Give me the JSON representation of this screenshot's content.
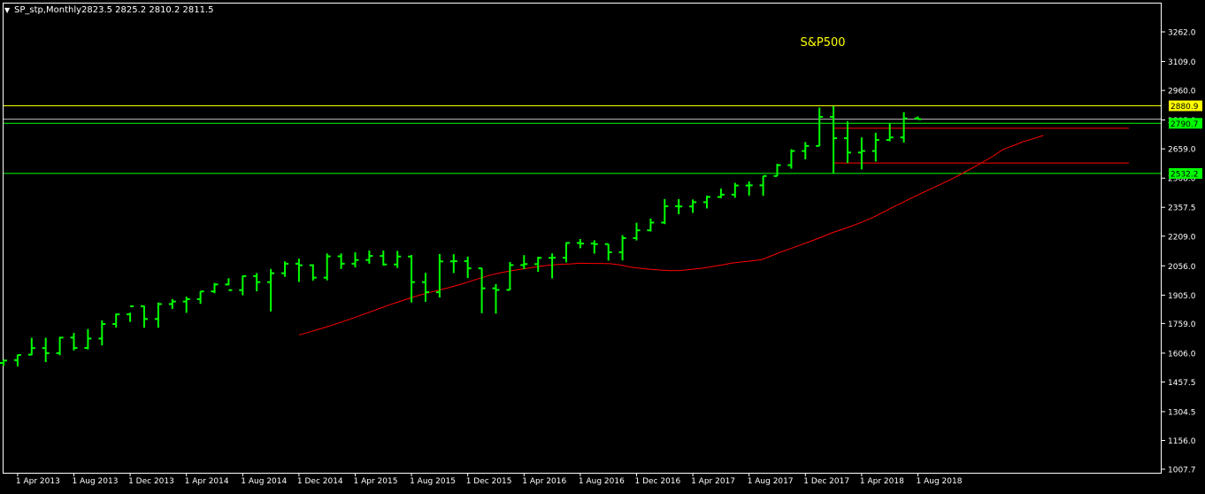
{
  "header": {
    "symbol_label": "SP_stp,Monthly",
    "ohlc_text": "2823.5 2825.2 2810.2 2811.5",
    "dropdown_glyph": "▼"
  },
  "chart_data": {
    "type": "ohlc",
    "title": "S&P500",
    "ylim": [
      1007.7,
      3262.0
    ],
    "y_ticks": [
      3262.0,
      3109.0,
      2960.0,
      2808.0,
      2659.0,
      2508.0,
      2357.5,
      2209.0,
      2056.0,
      1905.0,
      1759.0,
      1606.0,
      1457.5,
      1304.5,
      1156.0,
      1007.7
    ],
    "x_labels": [
      "1 Apr 2013",
      "1 Aug 2013",
      "1 Dec 2013",
      "1 Apr 2014",
      "1 Aug 2014",
      "1 Dec 2014",
      "1 Apr 2015",
      "1 Aug 2015",
      "1 Dec 2015",
      "1 Apr 2016",
      "1 Aug 2016",
      "1 Dec 2016",
      "1 Apr 2017",
      "1 Aug 2017",
      "1 Dec 2017",
      "1 Apr 2018",
      "1 Aug 2018"
    ],
    "first_bar": "Mar 2013",
    "bars": [
      [
        1555,
        1570,
        1540,
        1568
      ],
      [
        1570,
        1598,
        1538,
        1596
      ],
      [
        1598,
        1685,
        1595,
        1632
      ],
      [
        1632,
        1685,
        1560,
        1606
      ],
      [
        1606,
        1690,
        1595,
        1686
      ],
      [
        1686,
        1710,
        1620,
        1633
      ],
      [
        1633,
        1730,
        1625,
        1681
      ],
      [
        1681,
        1775,
        1646,
        1756
      ],
      [
        1756,
        1810,
        1738,
        1806
      ],
      [
        1806,
        1815,
        1767,
        1848
      ],
      [
        1848,
        1850,
        1737,
        1782
      ],
      [
        1782,
        1867,
        1737,
        1859
      ],
      [
        1859,
        1885,
        1834,
        1872
      ],
      [
        1872,
        1897,
        1814,
        1884
      ],
      [
        1884,
        1925,
        1860,
        1924
      ],
      [
        1924,
        1968,
        1915,
        1960
      ],
      [
        1960,
        1992,
        1955,
        1931
      ],
      [
        1931,
        2005,
        1904,
        2003
      ],
      [
        2003,
        2019,
        1925,
        1972
      ],
      [
        1972,
        2040,
        1821,
        2018
      ],
      [
        2018,
        2079,
        2000,
        2067
      ],
      [
        2067,
        2093,
        1973,
        2059
      ],
      [
        2059,
        2064,
        1980,
        1995
      ],
      [
        1995,
        2120,
        1981,
        2105
      ],
      [
        2105,
        2120,
        2040,
        2067
      ],
      [
        2067,
        2126,
        2048,
        2086
      ],
      [
        2086,
        2135,
        2067,
        2107
      ],
      [
        2107,
        2135,
        2057,
        2063
      ],
      [
        2063,
        2133,
        2045,
        2104
      ],
      [
        2104,
        2112,
        1867,
        1972
      ],
      [
        1972,
        2020,
        1871,
        1920
      ],
      [
        1920,
        2117,
        1893,
        2079
      ],
      [
        2079,
        2116,
        2019,
        2080
      ],
      [
        2080,
        2104,
        1993,
        2043
      ],
      [
        2043,
        2044,
        1812,
        1940
      ],
      [
        1940,
        1962,
        1810,
        1932
      ],
      [
        1932,
        2076,
        1931,
        2060
      ],
      [
        2060,
        2111,
        2039,
        2065
      ],
      [
        2065,
        2103,
        2025,
        2097
      ],
      [
        2097,
        2120,
        1991,
        2098
      ],
      [
        2098,
        2177,
        2074,
        2174
      ],
      [
        2174,
        2194,
        2147,
        2171
      ],
      [
        2171,
        2188,
        2119,
        2168
      ],
      [
        2168,
        2169,
        2083,
        2126
      ],
      [
        2126,
        2214,
        2084,
        2199
      ],
      [
        2199,
        2278,
        2187,
        2239
      ],
      [
        2239,
        2300,
        2233,
        2279
      ],
      [
        2279,
        2400,
        2271,
        2363
      ],
      [
        2363,
        2400,
        2322,
        2362
      ],
      [
        2362,
        2398,
        2329,
        2384
      ],
      [
        2384,
        2418,
        2352,
        2411
      ],
      [
        2411,
        2454,
        2405,
        2423
      ],
      [
        2423,
        2484,
        2407,
        2470
      ],
      [
        2470,
        2491,
        2418,
        2471
      ],
      [
        2471,
        2519,
        2417,
        2519
      ],
      [
        2519,
        2582,
        2519,
        2575
      ],
      [
        2575,
        2657,
        2557,
        2648
      ],
      [
        2648,
        2694,
        2605,
        2674
      ],
      [
        2674,
        2872,
        2673,
        2824
      ],
      [
        2824,
        2879,
        2533,
        2714
      ],
      [
        2714,
        2801,
        2586,
        2640
      ],
      [
        2640,
        2718,
        2553,
        2648
      ],
      [
        2648,
        2742,
        2594,
        2705
      ],
      [
        2705,
        2791,
        2698,
        2718
      ],
      [
        2718,
        2848,
        2691,
        2816
      ],
      [
        2816,
        2826,
        2810,
        2812
      ]
    ],
    "moving_average": {
      "start_bar": 21,
      "values": [
        1700,
        1714,
        1729,
        1745,
        1762,
        1780,
        1798,
        1817,
        1836,
        1855,
        1872,
        1889,
        1905,
        1919,
        1932,
        1945,
        1959,
        1976,
        1992,
        2008,
        2020,
        2030,
        2038,
        2046,
        2054,
        2060,
        2064,
        2066,
        2070,
        2068,
        2068,
        2067,
        2060,
        2049,
        2043,
        2038,
        2034,
        2031,
        2032,
        2038,
        2043,
        2052,
        2060,
        2070,
        2076,
        2081,
        2088,
        2108,
        2129,
        2147,
        2166,
        2185,
        2205,
        2226,
        2244,
        2262,
        2282,
        2304,
        2330,
        2357,
        2382,
        2408,
        2433,
        2457,
        2481,
        2506,
        2534,
        2561,
        2591,
        2621,
        2656,
        2675,
        2696,
        2711,
        2728
      ]
    },
    "price_levels": [
      {
        "value": 2880.9,
        "label": "2880.9",
        "kind": "yellow",
        "show_label": true
      },
      {
        "value": 2790.7,
        "label": "2790.7",
        "kind": "green",
        "show_label": true
      },
      {
        "value": 2812.0,
        "label": "",
        "kind": "gray",
        "show_label": false
      },
      {
        "value": 2532.2,
        "label": "2532.2",
        "kind": "green",
        "show_label": true
      }
    ],
    "red_segments": [
      {
        "value": 2765,
        "from_bar": 59,
        "to_bar": 80
      },
      {
        "value": 2586,
        "from_bar": 59,
        "to_bar": 80
      }
    ],
    "colors": {
      "background": "#000000",
      "bar": "#00FF00",
      "moving_average": "#FF0000",
      "title": "#FFFF00",
      "axis": "#FFFFFF",
      "yellow_level": "#FFFF00",
      "green_level": "#00FF00",
      "gray_level": "#C0C0C0",
      "red_level": "#FF0000"
    }
  }
}
